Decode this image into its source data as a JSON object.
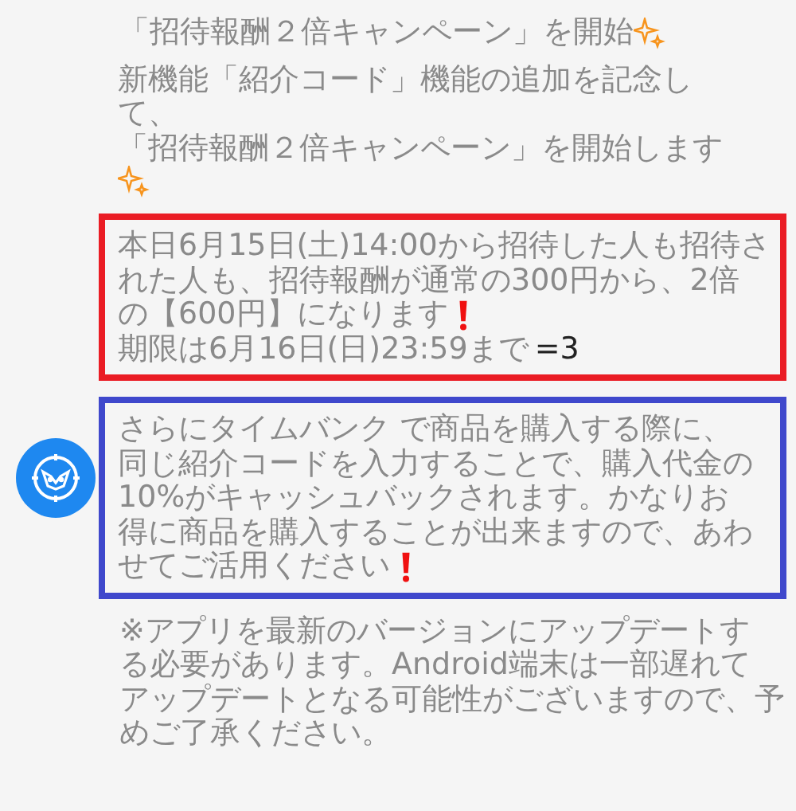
{
  "title": "「招待報酬２倍キャンペーン」を開始",
  "intro": [
    "新機能「紹介コード」機能の追加を記念し",
    "て、",
    "「招待報酬２倍キャンペーン」を開始します"
  ],
  "notices": [
    {
      "color": "#ea1c24",
      "lines": [
        {
          "text": "本日6月15日(土)14:00から招待した人も招待さ"
        },
        {
          "text": "れた人も、招待報酬が通常の300円から、2倍"
        },
        {
          "text": "の【600円】になります",
          "exclaim": true
        },
        {
          "text": "期限は6月16日(日)23:59まで",
          "suffix": "=3"
        }
      ]
    },
    {
      "color": "#3f48cc",
      "avatar": true,
      "lines": [
        {
          "text": "さらにタイムバンク で商品を購入する際に、"
        },
        {
          "text": "同じ紹介コードを入力することで、購入代金の"
        },
        {
          "text": "10%がキャッシュバックされます。かなりお"
        },
        {
          "text": "得に商品を購入することが出来ますので、あわ"
        },
        {
          "text": "せてご活用ください",
          "exclaim": true
        }
      ]
    }
  ],
  "note": [
    "※アプリを最新のバージョンにアップデートす",
    "る必要があります。Android端末は一部遅れて",
    "アップデートとなる可能性がございますので、予",
    "めご了承ください。"
  ]
}
